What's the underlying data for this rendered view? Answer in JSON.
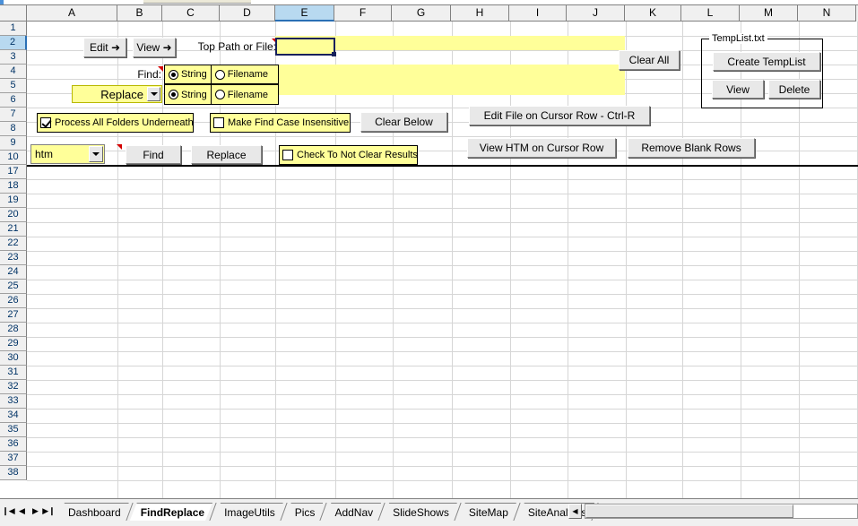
{
  "window": {
    "active_sheet": "FindReplace",
    "selected_cell": "E2",
    "selected_column": "E"
  },
  "grid": {
    "columns": [
      "A",
      "B",
      "C",
      "D",
      "E",
      "F",
      "G",
      "H",
      "I",
      "J",
      "K",
      "L",
      "M",
      "N"
    ],
    "rows": [
      1,
      2,
      3,
      4,
      5,
      6,
      7,
      8,
      9,
      10,
      17,
      18,
      19,
      20,
      21,
      22,
      23,
      24,
      25,
      26,
      27,
      28,
      29,
      30,
      31,
      32,
      33,
      34,
      35,
      36,
      37,
      38
    ],
    "hidden_rows_note": "11-16",
    "colors": {
      "input_highlight": "#ffff99",
      "selection_border": "#16215b",
      "header_selected": "#b8d9f0",
      "comment_marker": "#d40000",
      "gridline": "#d6d6d6",
      "separator": "#000000"
    }
  },
  "toolbar_row2": {
    "edit_button": "Edit ➜",
    "view_button": "View ➜",
    "top_path_label": "Top Path or File:",
    "top_path_value": ""
  },
  "find_section": {
    "find_label": "Find:",
    "find_value": "",
    "find_mode": {
      "options": [
        "String",
        "Filename"
      ],
      "selected": "String"
    },
    "replace_label": "Replace",
    "replace_value": "",
    "replace_mode": {
      "options": [
        "String",
        "Filename"
      ],
      "selected": "String"
    }
  },
  "options_row7": {
    "process_all_folders": {
      "label": "Process All Folders Underneath",
      "checked": true
    },
    "case_insensitive": {
      "label": "Make Find Case Insensitive",
      "checked": false
    },
    "clear_below_button": "Clear Below"
  },
  "actions_row9": {
    "extension_combo": {
      "value": "htm",
      "options": [
        "htm"
      ]
    },
    "find_button": "Find",
    "replace_button": "Replace",
    "not_clear_results": {
      "label": "Check To Not Clear Results",
      "checked": false
    }
  },
  "right_buttons": {
    "clear_all": "Clear All",
    "edit_file_cursor_row": "Edit File on Cursor Row - Ctrl-R",
    "view_htm_cursor_row": "View HTM on Cursor Row",
    "remove_blank_rows": "Remove Blank Rows"
  },
  "templist_group": {
    "title": "TempList.txt",
    "create_button": "Create TempList",
    "view_button": "View",
    "delete_button": "Delete"
  },
  "sheet_tabs": {
    "nav_first": "❙◀",
    "nav_prev": "◀",
    "nav_next": "▶",
    "nav_last": "▶❙",
    "items": [
      {
        "label": "Dashboard",
        "active": false
      },
      {
        "label": "FindReplace",
        "active": true
      },
      {
        "label": "ImageUtils",
        "active": false
      },
      {
        "label": "Pics",
        "active": false
      },
      {
        "label": "AddNav",
        "active": false
      },
      {
        "label": "SlideShows",
        "active": false
      },
      {
        "label": "SiteMap",
        "active": false
      },
      {
        "label": "SiteAnalysis",
        "active": false
      }
    ],
    "scroll_left": "◀"
  }
}
